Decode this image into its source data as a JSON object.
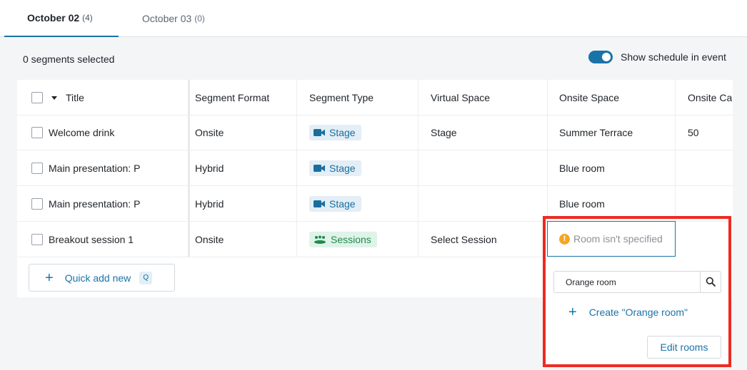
{
  "tabs": [
    {
      "label": "October 02",
      "count": "(4)"
    },
    {
      "label": "October 03",
      "count": "(0)"
    }
  ],
  "selection_text": "0 segments selected",
  "toggle": {
    "label": "Show schedule in event",
    "on": true
  },
  "table": {
    "headers": {
      "title": "Title",
      "format": "Segment Format",
      "type": "Segment Type",
      "virtual": "Virtual Space",
      "onsite": "Onsite Space",
      "capacity": "Onsite Ca"
    },
    "rows": [
      {
        "title": "Welcome drink",
        "format": "Onsite",
        "type": "Stage",
        "virtual": "Stage",
        "onsite": "Summer Terrace",
        "capacity": "50"
      },
      {
        "title": "Main presentation: P",
        "format": "Hybrid",
        "type": "Stage",
        "virtual": "",
        "onsite": "Blue room",
        "capacity": ""
      },
      {
        "title": "Main presentation: P",
        "format": "Hybrid",
        "type": "Stage",
        "virtual": "",
        "onsite": "Blue room",
        "capacity": ""
      },
      {
        "title": "Breakout session 1",
        "format": "Onsite",
        "type": "Sessions",
        "virtual": "Select Session",
        "onsite": "Room isn't specified",
        "capacity": ""
      }
    ],
    "warning_icon": "!"
  },
  "quick_add": {
    "label": "Quick add new",
    "shortcut": "Q"
  },
  "dropdown": {
    "search_value": "Orange room",
    "create_label": "Create \"Orange room\"",
    "edit_label": "Edit rooms"
  },
  "colors": {
    "accent": "#1a73a8",
    "stage_badge_bg": "#e3eef6",
    "sessions_badge_bg": "#e0f3e8",
    "sessions_text": "#1f8a4c",
    "warning": "#f5a623",
    "highlight": "#ee2a22"
  }
}
